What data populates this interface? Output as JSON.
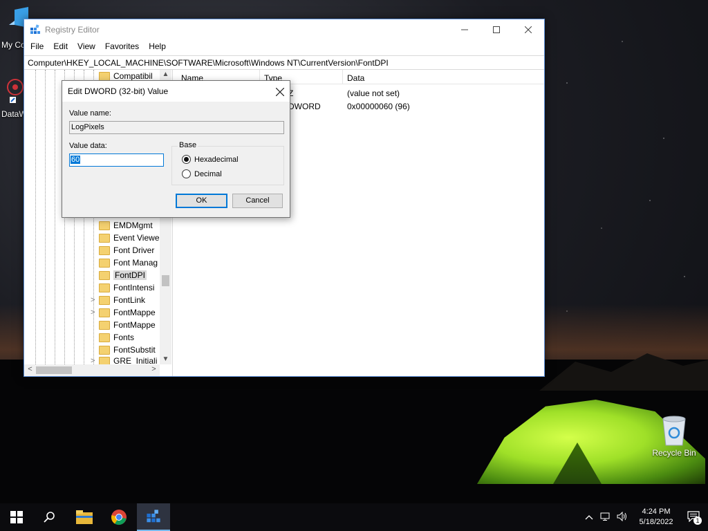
{
  "desktop": {
    "icons": [
      {
        "label": "My Co",
        "icon": "this-pc-icon"
      },
      {
        "label": "DataW",
        "icon": "datawrangler-shortcut-icon"
      },
      {
        "label": "Recycle Bin",
        "icon": "recycle-bin-icon"
      }
    ]
  },
  "window": {
    "title": "Registry Editor",
    "menu": [
      "File",
      "Edit",
      "View",
      "Favorites",
      "Help"
    ],
    "address": "Computer\\HKEY_LOCAL_MACHINE\\SOFTWARE\\Microsoft\\Windows NT\\CurrentVersion\\FontDPI",
    "tree": [
      {
        "label": "Compatibil",
        "expandable": false
      },
      {
        "label": "EMDMgmt",
        "expandable": false
      },
      {
        "label": "Event Viewe",
        "expandable": false
      },
      {
        "label": "Font Driver",
        "expandable": false
      },
      {
        "label": "Font Manag",
        "expandable": false
      },
      {
        "label": "FontDPI",
        "expandable": false,
        "selected": true
      },
      {
        "label": "FontIntensi",
        "expandable": false
      },
      {
        "label": "FontLink",
        "expandable": true
      },
      {
        "label": "FontMappe",
        "expandable": true
      },
      {
        "label": "FontMappe",
        "expandable": false
      },
      {
        "label": "Fonts",
        "expandable": false
      },
      {
        "label": "FontSubstit",
        "expandable": false
      },
      {
        "label": "GRE_Initiali",
        "expandable": true
      }
    ],
    "list": {
      "columns": [
        "Name",
        "Type",
        "Data"
      ],
      "rows": [
        {
          "type_fragment": "Z",
          "data": "(value not set)"
        },
        {
          "type_fragment": "DWORD",
          "data": "0x00000060 (96)"
        }
      ]
    }
  },
  "dialog": {
    "title": "Edit DWORD (32-bit) Value",
    "value_name_label": "Value name:",
    "value_name": "LogPixels",
    "value_data_label": "Value data:",
    "value_data": "60",
    "base_label": "Base",
    "base_options": [
      "Hexadecimal",
      "Decimal"
    ],
    "base_selected": "Hexadecimal",
    "ok_label": "OK",
    "cancel_label": "Cancel"
  },
  "taskbar": {
    "apps": [
      "start-icon",
      "search-icon",
      "file-explorer-icon",
      "chrome-icon",
      "registry-editor-icon"
    ],
    "time": "4:24 PM",
    "date": "5/18/2022",
    "notification_count": "1"
  }
}
